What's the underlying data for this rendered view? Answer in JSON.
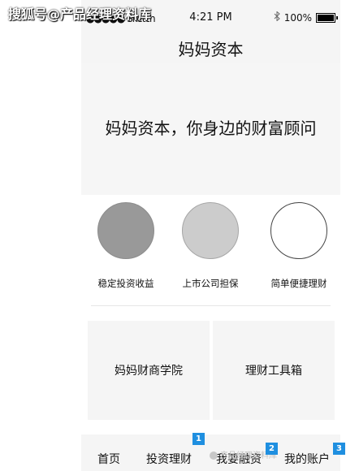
{
  "watermark": "搜狐号@产品经理资料库",
  "status_bar": {
    "signal": "●●●●●",
    "carrier": "Sketch",
    "time": "4:21 PM",
    "bluetooth_icon": "bluetooth-icon",
    "battery_percent": "100%",
    "battery_icon": "battery-icon"
  },
  "nav": {
    "title": "妈妈资本"
  },
  "banner": {
    "text": "妈妈资本，你身边的财富顾问"
  },
  "features": [
    {
      "label": "稳定投资收益",
      "circle_fill": "#999999",
      "circle_border": "#8c8c8c"
    },
    {
      "label": "上市公司担保",
      "circle_fill": "#cccccc",
      "circle_border": "#a6a6a6"
    },
    {
      "label": "简单便捷理财",
      "circle_fill": "#ffffff",
      "circle_border": "#444444"
    }
  ],
  "cards": [
    {
      "label": "妈妈财商学院"
    },
    {
      "label": "理财工具箱"
    }
  ],
  "tabs": [
    {
      "label": "首页"
    },
    {
      "label": "投资理财",
      "badge": "1"
    },
    {
      "label": "我要融资",
      "badge": "2"
    },
    {
      "label": "我的账户",
      "badge": "3"
    }
  ],
  "footer_watermark": "产品经理资料库",
  "colors": {
    "badge": "#1f8fe0",
    "bar_bg": "#f5f5f5"
  }
}
